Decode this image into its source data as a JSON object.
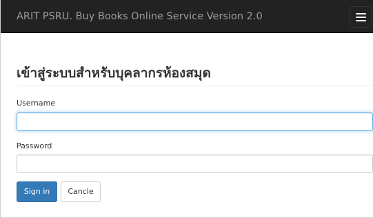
{
  "navbar": {
    "brand": "ARIT PSRU. Buy Books Online Service Version 2.0",
    "toggle_icon": "hamburger-menu-icon"
  },
  "form": {
    "title": "เข้าสู่ระบบสำหรับบุคลากรห้องสมุด",
    "username_label": "Username",
    "username_value": "",
    "password_label": "Password",
    "password_value": "",
    "sign_in_label": "Sign in",
    "cancel_label": "Cancle"
  },
  "colors": {
    "navbar_bg": "#222222",
    "brand_text": "#9d9d9d",
    "primary": "#337ab7",
    "focus_border": "#66afe9"
  }
}
